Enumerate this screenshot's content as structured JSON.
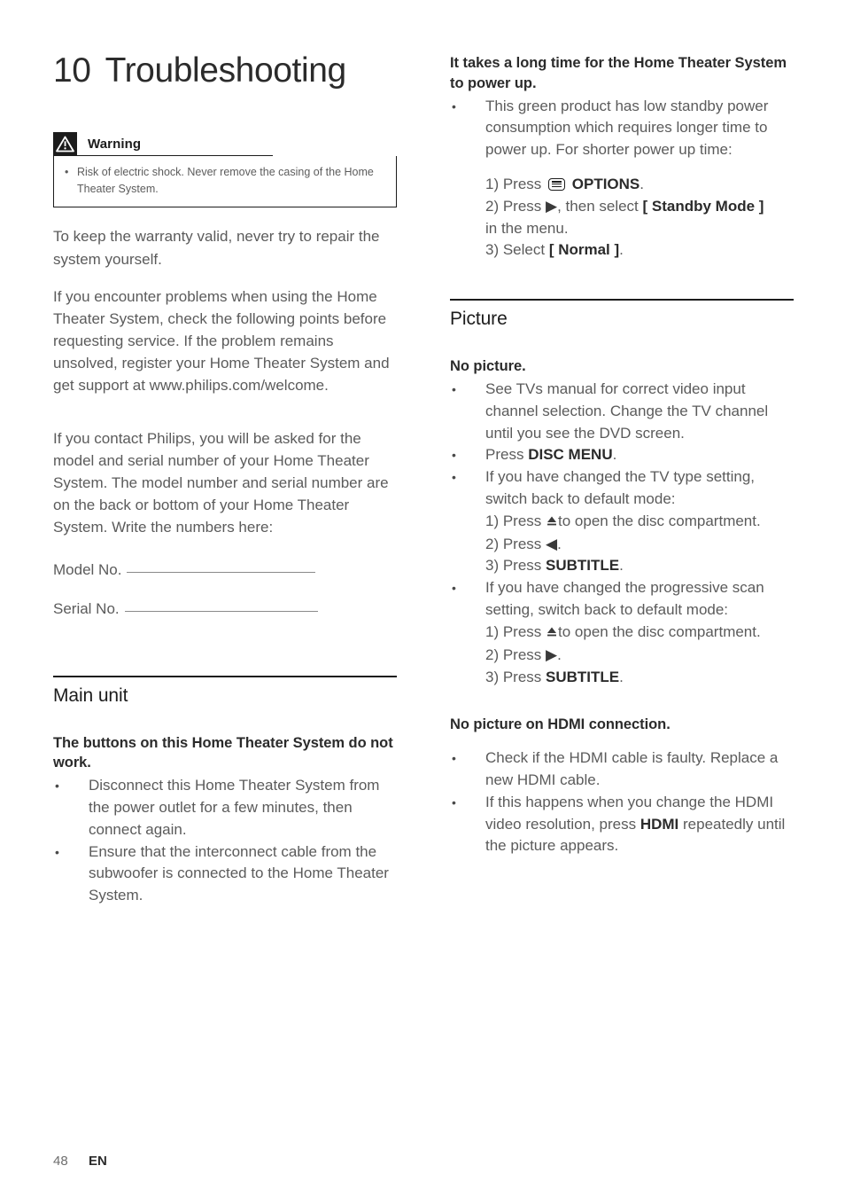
{
  "chapter": {
    "number": "10",
    "title": "Troubleshooting"
  },
  "warning": {
    "icon": "warning-triangle-icon",
    "title": "Warning",
    "items": [
      "Risk of electric shock. Never remove the casing of the Home Theater System."
    ]
  },
  "intro": {
    "paragraph1": "To keep the warranty valid, never try to repair the system yourself.",
    "paragraph2": "If you encounter problems when using the Home Theater System, check the following points before requesting service. If the problem remains unsolved, register your Home Theater System and get support at www.philips.com/welcome.",
    "paragraph3": "If you contact Philips, you will be asked for the model and serial number of your Home Theater System. The model number and serial number are on the back or bottom of your Home Theater System. Write the numbers here:",
    "model_label": "Model No.",
    "serial_label": "Serial No."
  },
  "main_unit": {
    "section_title": "Main unit",
    "problem1": {
      "heading": "The buttons on this Home Theater System do not work.",
      "bullets": [
        "Disconnect this Home Theater System from the power outlet for a few minutes, then connect again.",
        "Ensure that the interconnect cable from the subwoofer is connected to the Home Theater System."
      ]
    }
  },
  "power_up": {
    "heading": "It takes a long time for the Home Theater System to power up.",
    "bullet": "This green product has low standby power consumption which requires longer time to power up. For shorter power up time:",
    "steps": {
      "step1_prefix": "1) Press",
      "step1_key": "OPTIONS",
      "step1_suffix": ".",
      "step1_icon": "options-icon",
      "step2_prefix": "2) Press",
      "step2_arrow": "▶",
      "step2_mid": ", then select",
      "step2_value": "[ Standby Mode ]",
      "step2_suffix": "in the menu.",
      "step3_prefix": "3) Select",
      "step3_value": "[ Normal ]",
      "step3_suffix": "."
    }
  },
  "picture": {
    "section_title": "Picture",
    "problem_no_picture": {
      "heading": "No picture.",
      "bullet1": "See TVs manual for correct video input channel selection. Change the TV channel until you see the DVD screen.",
      "bullet2_prefix": "Press",
      "bullet2_key": "DISC MENU",
      "bullet2_suffix": ".",
      "bullet3": "If you have changed the TV type setting, switch back to default mode:",
      "bullet3_steps": {
        "s1_prefix": "1) Press",
        "s1_icon": "eject-icon",
        "s1_suffix": "to open the disc compartment.",
        "s2_prefix": "2) Press",
        "s2_arrow": "◀",
        "s2_suffix": ".",
        "s3_prefix": "3) Press",
        "s3_key": "SUBTITLE",
        "s3_suffix": "."
      },
      "bullet4": "If you have changed the progressive scan setting, switch back to default mode:",
      "bullet4_steps": {
        "s1_prefix": "1) Press",
        "s1_icon": "eject-icon",
        "s1_suffix": "to open the disc compartment.",
        "s2_prefix": "2) Press",
        "s2_arrow": "▶",
        "s2_suffix": ".",
        "s3_prefix": "3) Press",
        "s3_key": "SUBTITLE",
        "s3_suffix": "."
      }
    },
    "problem_hdmi": {
      "heading": "No picture on HDMI connection.",
      "bullet1": "Check if the HDMI cable is faulty. Replace a new HDMI cable.",
      "bullet2_prefix": "If this happens when you change the HDMI video resolution, press",
      "bullet2_key": "HDMI",
      "bullet2_suffix": "repeatedly until the picture appears."
    }
  },
  "footer": {
    "page_number": "48",
    "language": "EN"
  }
}
